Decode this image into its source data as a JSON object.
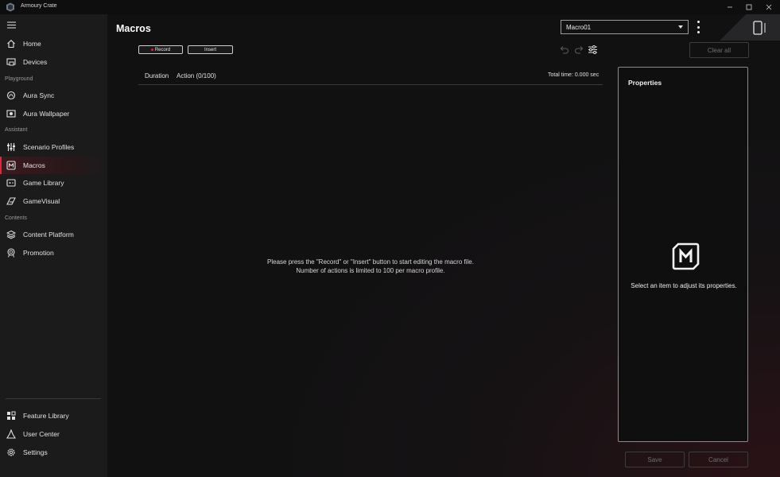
{
  "window": {
    "title": "Armoury Crate",
    "controls": [
      "minimize-icon",
      "maximize-icon",
      "close-icon"
    ]
  },
  "sidebar": {
    "items": [
      {
        "label": "Home",
        "icon": "home-icon"
      },
      {
        "label": "Devices",
        "icon": "devices-icon"
      },
      {
        "section": "Playground"
      },
      {
        "label": "Aura Sync",
        "icon": "aura-sync-icon"
      },
      {
        "label": "Aura Wallpaper",
        "icon": "wallpaper-icon"
      },
      {
        "section": "Assistant"
      },
      {
        "label": "Scenario Profiles",
        "icon": "sliders-icon"
      },
      {
        "label": "Macros",
        "icon": "macro-icon",
        "active": true
      },
      {
        "label": "Game Library",
        "icon": "game-library-icon"
      },
      {
        "label": "GameVisual",
        "icon": "gamevisual-icon"
      },
      {
        "section": "Contents"
      },
      {
        "label": "Content Platform",
        "icon": "layers-icon"
      },
      {
        "label": "Promotion",
        "icon": "award-icon"
      },
      {
        "label": "Feature Library",
        "icon": "grid-icon"
      },
      {
        "label": "User Center",
        "icon": "user-icon"
      },
      {
        "label": "Settings",
        "icon": "gear-icon"
      }
    ]
  },
  "main": {
    "title": "Macros",
    "profile_select": {
      "value": "Macro01"
    },
    "toolbar": {
      "record_label": "Record",
      "insert_label": "Insert",
      "clear_all_label": "Clear all"
    },
    "table": {
      "columns": [
        "Duration",
        "Action (0/100)"
      ],
      "total_time": "Total time: 0.000 sec"
    },
    "empty_message": [
      "Please press the \"Record\" or \"Insert\" button to start editing the macro file.",
      "Number of actions is limited to 100 per macro profile."
    ],
    "properties": {
      "title": "Properties",
      "message": "Select an item to adjust its properties."
    },
    "footer": {
      "save_label": "Save",
      "cancel_label": "Cancel"
    }
  },
  "colors": {
    "accent": "#e2263a",
    "background": "#111112",
    "sidebar": "#1b1b1c"
  }
}
